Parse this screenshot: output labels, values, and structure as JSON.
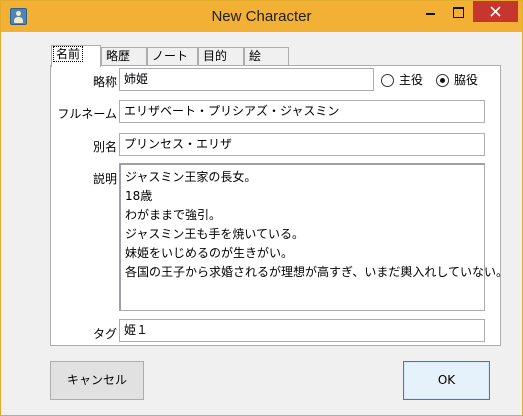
{
  "window": {
    "title": "New Character"
  },
  "tabs": [
    {
      "label": "名前"
    },
    {
      "label": "略歴"
    },
    {
      "label": "ノート"
    },
    {
      "label": "目的"
    },
    {
      "label": "絵"
    }
  ],
  "form": {
    "short_name": {
      "label": "略称",
      "value": "姉姫"
    },
    "role": {
      "option_main": "主役",
      "option_side": "脇役",
      "selected": "脇役"
    },
    "full_name": {
      "label": "フルネーム",
      "value": "エリザベート・プリシアズ・ジャスミン"
    },
    "alias": {
      "label": "別名",
      "value": "プリンセス・エリザ"
    },
    "description": {
      "label": "説明",
      "lines": [
        "ジャスミン王家の長女。",
        "18歳",
        "わがままで強引。",
        "ジャスミン王も手を焼いている。",
        "妹姫をいじめるのが生きがい。",
        "各国の王子から求婚されるが理想が高すぎ、いまだ輿入れしていない。"
      ]
    },
    "tag": {
      "label": "タグ",
      "value": "姫１"
    }
  },
  "buttons": {
    "cancel": "キャンセル",
    "ok": "OK"
  }
}
